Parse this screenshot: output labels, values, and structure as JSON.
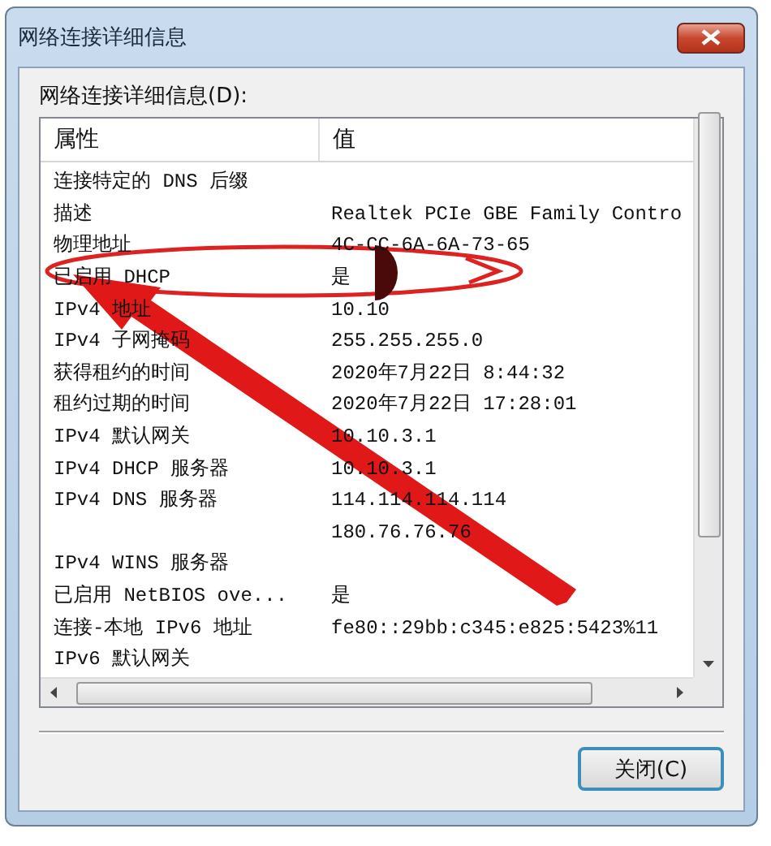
{
  "window": {
    "title": "网络连接详细信息"
  },
  "list_label": "网络连接详细信息(D):",
  "table": {
    "columns": [
      "属性",
      "值"
    ],
    "rows": [
      {
        "property": "连接特定的 DNS 后缀",
        "value": ""
      },
      {
        "property": "描述",
        "value": "Realtek PCIe GBE Family Contro"
      },
      {
        "property": "物理地址",
        "value": "4C-CC-6A-6A-73-65"
      },
      {
        "property": "已启用 DHCP",
        "value": "是"
      },
      {
        "property": "IPv4 地址",
        "value": "10.10"
      },
      {
        "property": "IPv4 子网掩码",
        "value": "255.255.255.0"
      },
      {
        "property": "获得租约的时间",
        "value": "2020年7月22日 8:44:32"
      },
      {
        "property": "租约过期的时间",
        "value": "2020年7月22日 17:28:01"
      },
      {
        "property": "IPv4 默认网关",
        "value": "10.10.3.1"
      },
      {
        "property": "IPv4 DHCP 服务器",
        "value": "10.10.3.1"
      },
      {
        "property": "IPv4 DNS 服务器",
        "value": "114.114.114.114"
      },
      {
        "property": "",
        "value": "180.76.76.76"
      },
      {
        "property": "IPv4 WINS 服务器",
        "value": ""
      },
      {
        "property": "已启用 NetBIOS ove...",
        "value": "是"
      },
      {
        "property": "连接-本地 IPv6 地址",
        "value": "fe80::29bb:c345:e825:5423%11"
      },
      {
        "property": "IPv6 默认网关",
        "value": ""
      }
    ]
  },
  "annotations": [
    {
      "kind": "ellipse"
    },
    {
      "kind": "arrow"
    },
    {
      "kind": "chevron"
    },
    {
      "kind": "blot"
    }
  ],
  "buttons": [
    "关闭(C)"
  ]
}
